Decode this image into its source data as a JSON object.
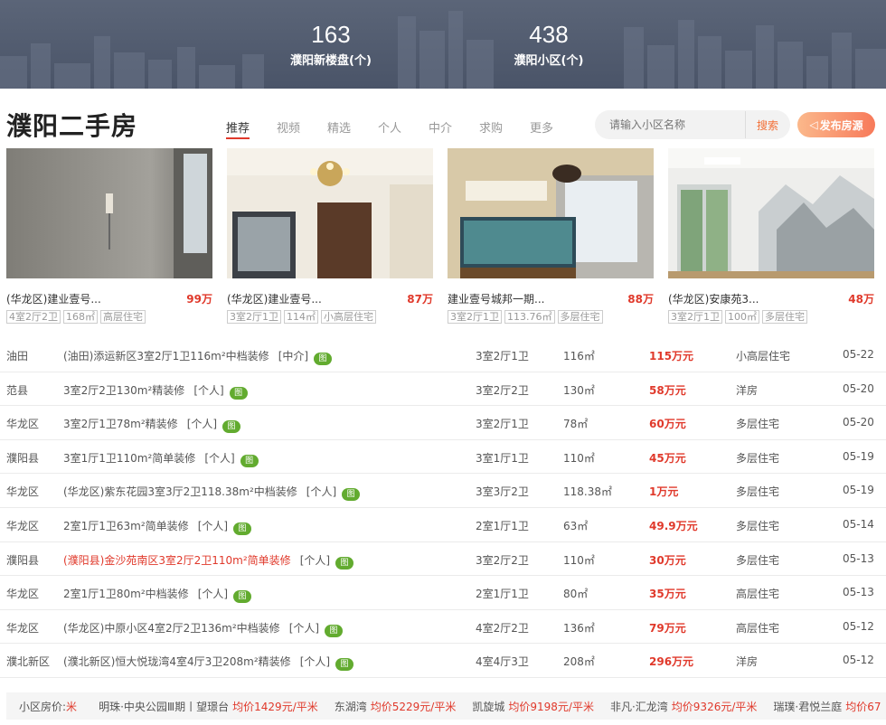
{
  "banner": {
    "stats": [
      {
        "num": "163",
        "label": "濮阳新楼盘(个)"
      },
      {
        "num": "438",
        "label": "濮阳小区(个)"
      }
    ]
  },
  "header": {
    "title": "濮阳二手房",
    "tabs": [
      "推荐",
      "视频",
      "精选",
      "个人",
      "中介",
      "求购",
      "更多"
    ],
    "search_placeholder": "请输入小区名称",
    "search_button": "搜索",
    "publish_button": "发布房源"
  },
  "cards": [
    {
      "name": "(华龙区)建业壹号...",
      "price": "99万",
      "tags": [
        "4室2厅2卫",
        "168㎡",
        "高层住宅"
      ]
    },
    {
      "name": "(华龙区)建业壹号...",
      "price": "87万",
      "tags": [
        "3室2厅1卫",
        "114㎡",
        "小高层住宅"
      ]
    },
    {
      "name": "建业壹号城邦一期...",
      "price": "88万",
      "tags": [
        "3室2厅1卫",
        "113.76㎡",
        "多层住宅"
      ]
    },
    {
      "name": "(华龙区)安康苑3...",
      "price": "48万",
      "tags": [
        "3室2厅1卫",
        "100㎡",
        "多层住宅"
      ]
    }
  ],
  "listings": [
    {
      "area": "油田",
      "title": "(油田)添运新区3室2厅1卫116m²中档装修",
      "source": "[中介]",
      "badge": "图",
      "rooms": "3室2厅1卫",
      "size": "116㎡",
      "price": "115万元",
      "type": "小高层住宅",
      "date": "05-22"
    },
    {
      "area": "范县",
      "title": "3室2厅2卫130m²精装修",
      "source": "[个人]",
      "badge": "图",
      "rooms": "3室2厅2卫",
      "size": "130㎡",
      "price": "58万元",
      "type": "洋房",
      "date": "05-20"
    },
    {
      "area": "华龙区",
      "title": "3室2厅1卫78m²精装修",
      "source": "[个人]",
      "badge": "图",
      "rooms": "3室2厅1卫",
      "size": "78㎡",
      "price": "60万元",
      "type": "多层住宅",
      "date": "05-20"
    },
    {
      "area": "濮阳县",
      "title": "3室1厅1卫110m²简单装修",
      "source": "[个人]",
      "badge": "图",
      "rooms": "3室1厅1卫",
      "size": "110㎡",
      "price": "45万元",
      "type": "多层住宅",
      "date": "05-19"
    },
    {
      "area": "华龙区",
      "title": "(华龙区)紫东花园3室3厅2卫118.38m²中档装修",
      "source": "[个人]",
      "badge": "图",
      "rooms": "3室3厅2卫",
      "size": "118.38㎡",
      "price": "1万元",
      "type": "多层住宅",
      "date": "05-19"
    },
    {
      "area": "华龙区",
      "title": "2室1厅1卫63m²简单装修",
      "source": "[个人]",
      "badge": "图",
      "rooms": "2室1厅1卫",
      "size": "63㎡",
      "price": "49.9万元",
      "type": "多层住宅",
      "date": "05-14"
    },
    {
      "area": "濮阳县",
      "title": "(濮阳县)金沙苑南区3室2厅2卫110m²简单装修",
      "source": "[个人]",
      "badge": "图",
      "rooms": "3室2厅2卫",
      "size": "110㎡",
      "price": "30万元",
      "type": "多层住宅",
      "date": "05-13",
      "highlight": true
    },
    {
      "area": "华龙区",
      "title": "2室1厅1卫80m²中档装修",
      "source": "[个人]",
      "badge": "图",
      "rooms": "2室1厅1卫",
      "size": "80㎡",
      "price": "35万元",
      "type": "高层住宅",
      "date": "05-13"
    },
    {
      "area": "华龙区",
      "title": "(华龙区)中原小区4室2厅2卫136m²中档装修",
      "source": "[个人]",
      "badge": "图",
      "rooms": "4室2厅2卫",
      "size": "136㎡",
      "price": "79万元",
      "type": "高层住宅",
      "date": "05-12"
    },
    {
      "area": "濮北新区",
      "title": "(濮北新区)恒大悦珑湾4室4厅3卫208m²精装修",
      "source": "[个人]",
      "badge": "图",
      "rooms": "4室4厅3卫",
      "size": "208㎡",
      "price": "296万元",
      "type": "洋房",
      "date": "05-12"
    }
  ],
  "bottom_bar": {
    "label": "小区房价:",
    "star": "米",
    "items": [
      {
        "name": "明珠·中央公园Ⅲ期丨望璟台",
        "price": "均价1429元/平米"
      },
      {
        "name": "东湖湾",
        "price": "均价5229元/平米"
      },
      {
        "name": "凯旋城",
        "price": "均价9198元/平米"
      },
      {
        "name": "非凡·汇龙湾",
        "price": "均价9326元/平米"
      },
      {
        "name": "瑞璞·君悦兰庭",
        "price": "均价67"
      }
    ]
  }
}
